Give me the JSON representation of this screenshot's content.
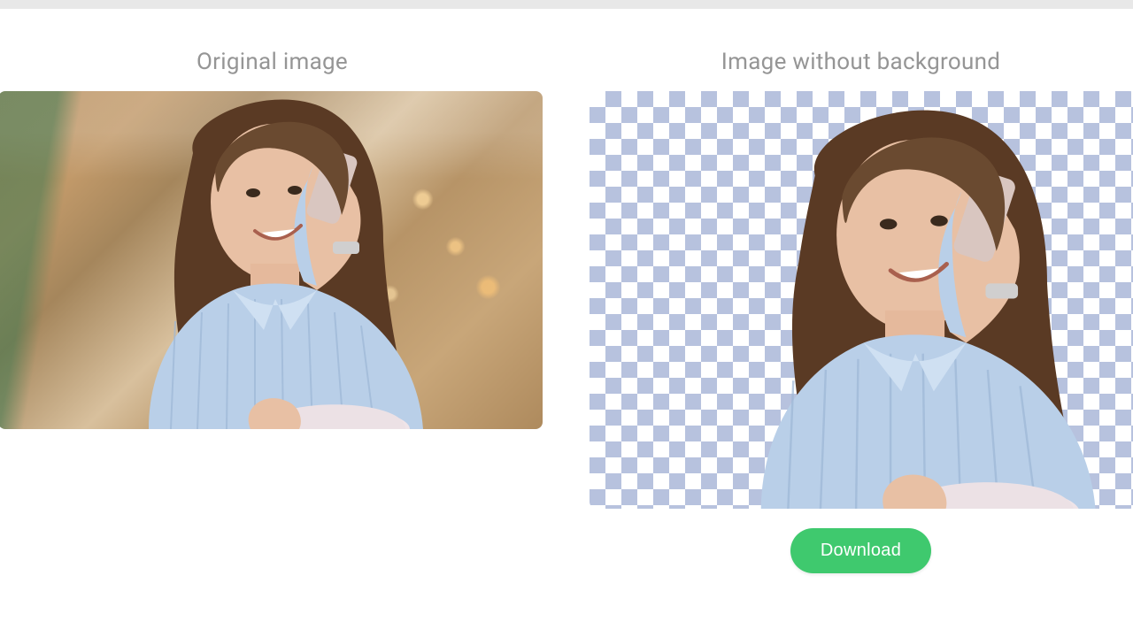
{
  "panels": {
    "original": {
      "title": "Original image"
    },
    "result": {
      "title": "Image without background"
    }
  },
  "actions": {
    "download_label": "Download"
  },
  "colors": {
    "accent": "#3fc96e",
    "checker_dark": "#b7c2de",
    "checker_light": "#ffffff",
    "title_text": "#959595"
  }
}
